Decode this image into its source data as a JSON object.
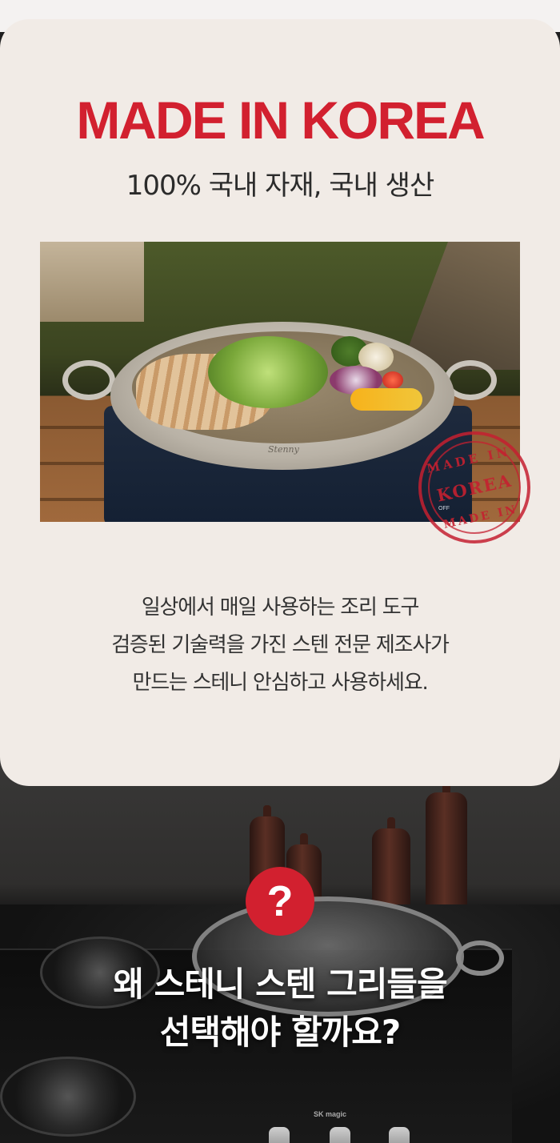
{
  "hero": {
    "headline": "MADE IN KOREA",
    "subheadline": "100% 국내 자재, 국내 생산"
  },
  "photo": {
    "pan_logo": "Stenny",
    "stove_label": "OFF"
  },
  "stamp": {
    "top": "MADE IN",
    "middle": "KOREA",
    "bottom": "MADE IN"
  },
  "description": {
    "lines": [
      "일상에서 매일 사용하는 조리 도구",
      "검증된 기술력을 가진 스텐 전문 제조사가",
      "만드는 스테니 안심하고 사용하세요."
    ]
  },
  "question": {
    "badge": "?",
    "lines": [
      "왜 스테니 스텐 그리들을",
      "선택해야 할까요?"
    ]
  },
  "scene": {
    "cooktop_brand": "SK magic"
  },
  "colors": {
    "accent_red": "#d2202f",
    "card_bg": "#f1ebe6"
  }
}
